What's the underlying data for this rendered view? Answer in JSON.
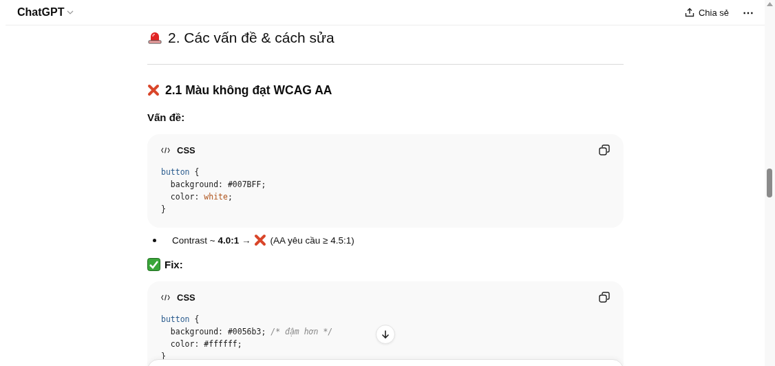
{
  "header": {
    "title": "ChatGPT",
    "share": "Chia sẻ",
    "more": "⋯"
  },
  "sections": [
    {
      "kind": "h2",
      "text": "2. Các vấn đề & cách sửa"
    },
    {
      "kind": "rule"
    },
    {
      "kind": "h3",
      "text": "2.1 Màu không đạt WCAG AA"
    },
    {
      "kind": "label",
      "text": "Vấn đề:"
    },
    {
      "kind": "code",
      "language": "CSS",
      "lines": [
        [
          {
            "text": "button",
            "kind": "selector"
          },
          {
            "text": " {",
            "kind": "plain"
          }
        ],
        [
          {
            "text": "  background: #007BFF;",
            "kind": "plain"
          }
        ],
        [
          {
            "text": "  color: ",
            "kind": "plain"
          },
          {
            "text": "white",
            "kind": "value"
          },
          {
            "text": ";",
            "kind": "plain"
          }
        ],
        [
          {
            "text": "}",
            "kind": "plain"
          }
        ]
      ]
    },
    {
      "kind": "bullet",
      "before": "Contrast ~ **4.0:1** →",
      "after": "(AA yêu cầu ≥ 4.5:1)"
    },
    {
      "kind": "check_label",
      "text": "Fix:"
    },
    {
      "kind": "code",
      "language": "CSS",
      "lines": [
        [
          {
            "text": "button",
            "kind": "selector"
          },
          {
            "text": " {",
            "kind": "plain"
          }
        ],
        [
          {
            "text": "  background: #0056b3; ",
            "kind": "plain"
          },
          {
            "text": "/* đậm hơn */",
            "kind": "comment"
          }
        ],
        [
          {
            "text": "  color: #ffffff;",
            "kind": "plain"
          }
        ],
        [
          {
            "text": "}",
            "kind": "plain"
          }
        ]
      ]
    }
  ]
}
